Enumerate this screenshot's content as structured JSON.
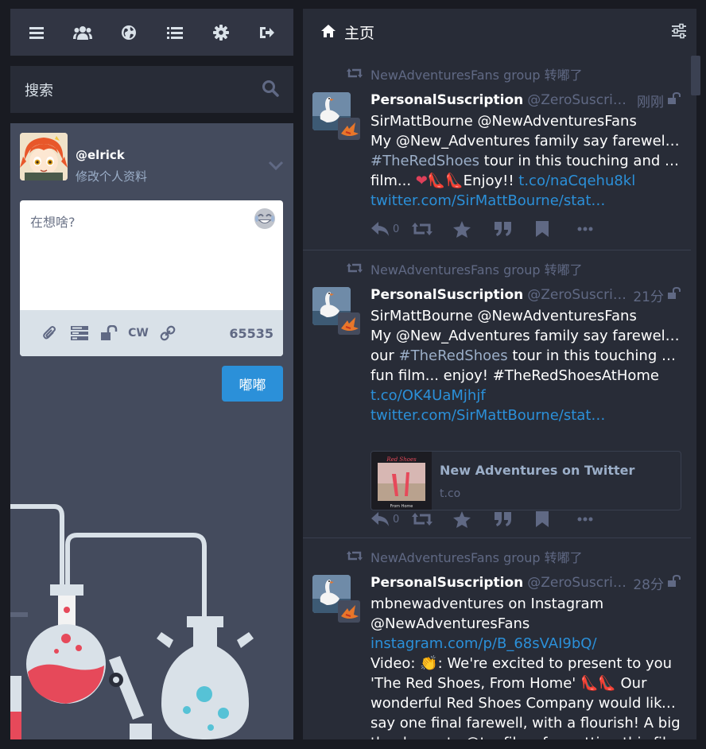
{
  "nav": {
    "icons": [
      "menu-icon",
      "users-icon",
      "globe-icon",
      "list-icon",
      "gear-icon",
      "logout-icon"
    ]
  },
  "search": {
    "placeholder": "搜索"
  },
  "compose": {
    "handle": "@elrick",
    "edit_profile": "修改个人资料",
    "placeholder": "在想啥?",
    "cw_label": "CW",
    "char_count": "65535",
    "toot_label": "嘟嘟"
  },
  "column": {
    "title": "主页"
  },
  "statuses": [
    {
      "prepend": "NewAdventuresFans group 转嘟了",
      "display_name": "PersonalSuscription",
      "acct": "@ZeroSuscription…",
      "time": "刚刚",
      "lines": [
        {
          "parts": [
            {
              "t": "SirMattBourne @NewAdventuresFans",
              "c": ""
            }
          ]
        },
        {
          "parts": [
            {
              "t": " My @New_Adventures family say farewell to",
              "c": ""
            }
          ]
        },
        {
          "parts": [
            {
              "t": "#TheRedShoes",
              "c": "m"
            },
            {
              "t": " tour in this touching and fun",
              "c": ""
            }
          ]
        },
        {
          "parts": [
            {
              "t": "film... ",
              "c": ""
            },
            {
              "t": "❤👠👠",
              "c": "hearts"
            },
            {
              "t": "Enjoy!! ",
              "c": ""
            },
            {
              "t": "t.co/naCqehu8kl",
              "c": "a"
            }
          ]
        },
        {
          "parts": [
            {
              "t": " twitter.com/SirMattBourne/stat…",
              "c": "a"
            }
          ]
        }
      ],
      "reply_count": "0"
    },
    {
      "prepend": "NewAdventuresFans group 转嘟了",
      "display_name": "PersonalSuscription",
      "acct": "@ZeroSuscription…",
      "time": "21分",
      "lines": [
        {
          "parts": [
            {
              "t": "SirMattBourne @NewAdventuresFans",
              "c": ""
            }
          ]
        },
        {
          "parts": [
            {
              "t": " My @New_Adventures family say farewell to",
              "c": ""
            }
          ]
        },
        {
          "parts": [
            {
              "t": "our ",
              "c": ""
            },
            {
              "t": "#TheRedShoes",
              "c": "m"
            },
            {
              "t": " tour in this touching and",
              "c": ""
            }
          ]
        },
        {
          "parts": [
            {
              "t": "fun film... enjoy! #TheRedShoesAtHome",
              "c": ""
            }
          ]
        },
        {
          "parts": [
            {
              "t": "t.co/OK4UaMjhjf",
              "c": "a"
            }
          ]
        },
        {
          "parts": [
            {
              "t": " twitter.com/SirMattBourne/stat…",
              "c": "a"
            }
          ]
        }
      ],
      "card": {
        "title": "New Adventures on Twitter",
        "host": "t.co"
      },
      "reply_count": "0"
    },
    {
      "prepend": "NewAdventuresFans group 转嘟了",
      "display_name": "PersonalSuscription",
      "acct": "@ZeroSuscription…",
      "time": "28分",
      "lines": [
        {
          "parts": [
            {
              "t": "mbnewadventures on Instagram",
              "c": ""
            }
          ]
        },
        {
          "parts": [
            {
              "t": "@NewAdventuresFans",
              "c": ""
            }
          ]
        },
        {
          "parts": [
            {
              "t": " instagram.com/p/B_68sVAI9bQ/",
              "c": "a"
            }
          ]
        },
        {
          "parts": [
            {
              "t": " Video:  👏: We're excited to present to you",
              "c": ""
            }
          ]
        },
        {
          "parts": [
            {
              "t": "'The Red Shoes, From Home' ",
              "c": ""
            },
            {
              "t": "👠👠",
              "c": "hearts"
            },
            {
              "t": "  Our",
              "c": ""
            }
          ]
        },
        {
          "parts": [
            {
              "t": "wonderful Red Shoes Company would like to",
              "c": ""
            }
          ]
        },
        {
          "parts": [
            {
              "t": "say one final farewell, with a flourish!  A big",
              "c": ""
            }
          ]
        },
        {
          "parts": [
            {
              "t": "thank you to @tanfilms for putting this film",
              "c": ""
            }
          ]
        }
      ]
    }
  ],
  "colors": {
    "accent": "#2b90d9",
    "bg": "#191b22",
    "panel": "#282c37",
    "muted": "#606984"
  }
}
